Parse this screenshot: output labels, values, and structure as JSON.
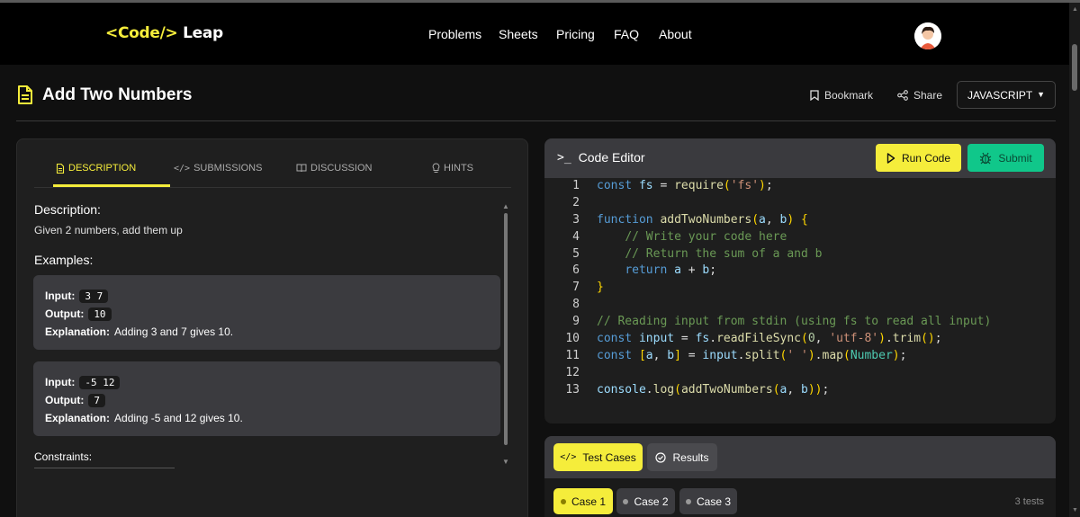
{
  "header": {
    "logo_left": "<Code/>",
    "logo_right": "Leap",
    "nav": [
      "Problems",
      "Sheets",
      "Pricing",
      "FAQ",
      "About"
    ]
  },
  "problem": {
    "title": "Add Two Numbers",
    "bookmark_label": "Bookmark",
    "share_label": "Share",
    "language": "JAVASCRIPT"
  },
  "left_panel": {
    "tabs": [
      "DESCRIPTION",
      "SUBMISSIONS",
      "DISCUSSION",
      "HINTS"
    ],
    "active_tab": "DESCRIPTION",
    "description_heading": "Description:",
    "description_text": "Given 2 numbers, add them up",
    "examples_heading": "Examples:",
    "input_label": "Input:",
    "output_label": "Output:",
    "explanation_label": "Explanation:",
    "examples": [
      {
        "input": "3 7",
        "output": "10",
        "explanation": "Adding 3 and 7 gives 10."
      },
      {
        "input": "-5 12",
        "output": "7",
        "explanation": "Adding -5 and 12 gives 10."
      }
    ],
    "constraints_heading": "Constraints:"
  },
  "editor": {
    "title": "Code Editor",
    "run_label": "Run Code",
    "submit_label": "Submit",
    "lines": [
      "const fs = require('fs');",
      "",
      "function addTwoNumbers(a, b) {",
      "    // Write your code here",
      "    // Return the sum of a and b",
      "    return a + b;",
      "}",
      "",
      "// Reading input from stdin (using fs to read all input)",
      "const input = fs.readFileSync(0, 'utf-8').trim();",
      "const [a, b] = input.split(' ').map(Number);",
      "",
      "console.log(addTwoNumbers(a, b));"
    ]
  },
  "tests": {
    "test_cases_label": "Test Cases",
    "results_label": "Results",
    "cases": [
      "Case 1",
      "Case 2",
      "Case 3"
    ],
    "active_case": "Case 1",
    "count_label": "3 tests"
  },
  "colors": {
    "accent": "#f5ed3b",
    "submit": "#10c78a",
    "panel": "#1f1f1f",
    "header_bar": "#3a3a3e"
  }
}
